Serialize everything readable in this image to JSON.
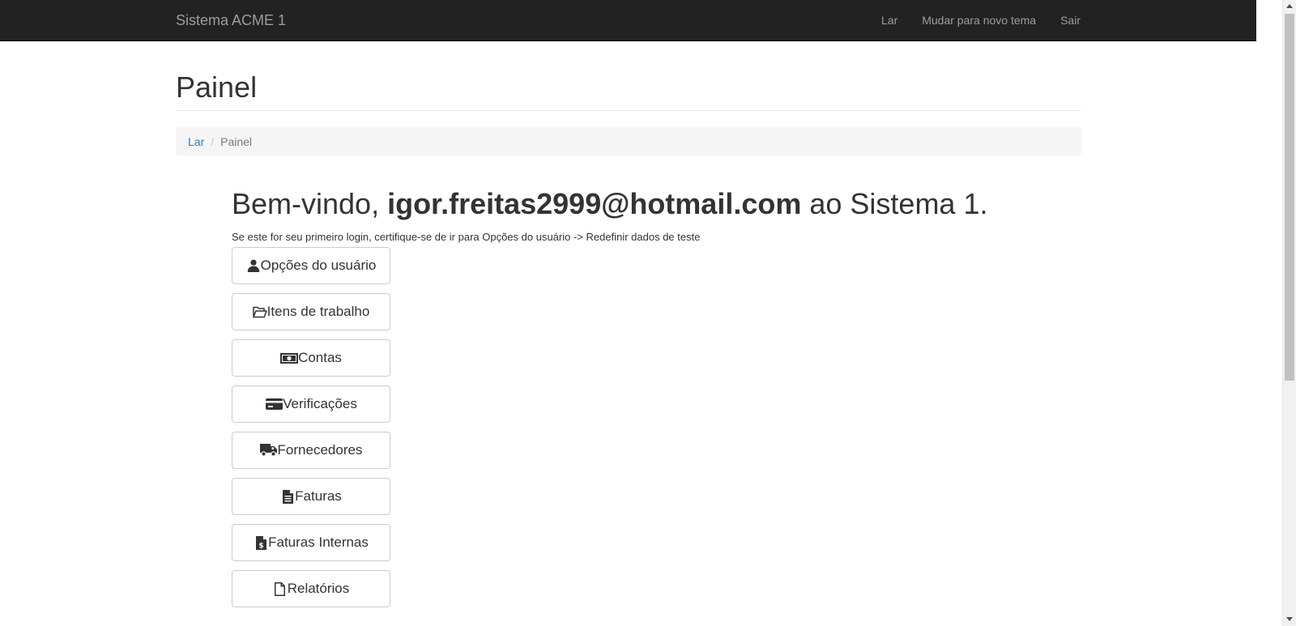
{
  "navbar": {
    "brand": "Sistema ACME 1",
    "links": [
      "Lar",
      "Mudar para novo tema",
      "Sair"
    ]
  },
  "header": {
    "title": "Painel"
  },
  "breadcrumb": {
    "home": "Lar",
    "separator": "/",
    "current": "Painel"
  },
  "welcome": {
    "prefix": "Bem-vindo, ",
    "email": "igor.freitas2999@hotmail.com",
    "suffix": " ao Sistema 1.",
    "note": "Se este for seu primeiro login, certifique-se de ir para Opções do usuário -> Redefinir dados de teste"
  },
  "menu": [
    {
      "label": "Opções do usuário",
      "icon": "user-icon"
    },
    {
      "label": "Itens de trabalho",
      "icon": "folder-open-icon"
    },
    {
      "label": "Contas",
      "icon": "money-icon"
    },
    {
      "label": "Verificações",
      "icon": "credit-card-icon"
    },
    {
      "label": "Fornecedores",
      "icon": "truck-icon"
    },
    {
      "label": "Faturas",
      "icon": "file-text-icon"
    },
    {
      "label": "Faturas Internas",
      "icon": "file-invoice-dollar-icon"
    },
    {
      "label": "Relatórios",
      "icon": "file-icon"
    }
  ],
  "colors": {
    "navbar_bg": "#222222",
    "navbar_text": "#9d9d9d",
    "link": "#337ab7",
    "breadcrumb_bg": "#f5f5f5"
  }
}
